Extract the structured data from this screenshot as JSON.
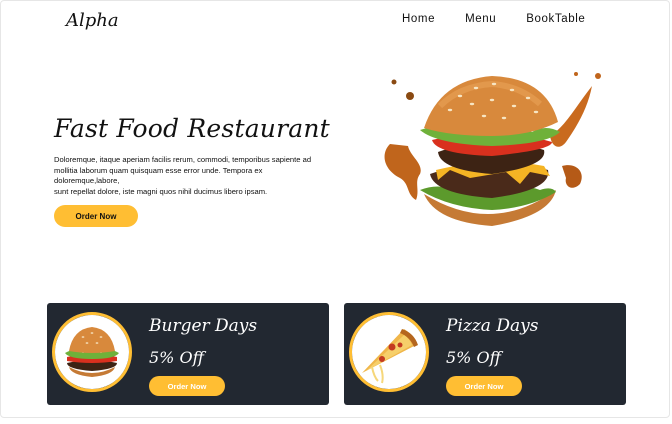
{
  "header": {
    "brand": "Alpha",
    "nav": [
      "Home",
      "Menu",
      "BookTable"
    ]
  },
  "hero": {
    "title": "Fast Food Restaurant",
    "text_lines": [
      "Doloremque, itaque aperiam facilis rerum, commodi, temporibus sapiente ad",
      "mollitia laborum quam quisquam esse error unde. Tempora ex",
      "doloremque,labore,",
      "sunt repellat dolore, iste magni quos nihil ducimus libero ipsam."
    ],
    "button": "Order Now"
  },
  "offers": [
    {
      "title": "Burger Days",
      "discount": "5% Off",
      "button": "Order Now",
      "image": "burger-image"
    },
    {
      "title": "Pizza Days",
      "discount": "5% Off",
      "button": "Order Now",
      "image": "pizza-image"
    }
  ],
  "colors": {
    "accent": "#ffbe33",
    "card_bg": "#222831"
  }
}
